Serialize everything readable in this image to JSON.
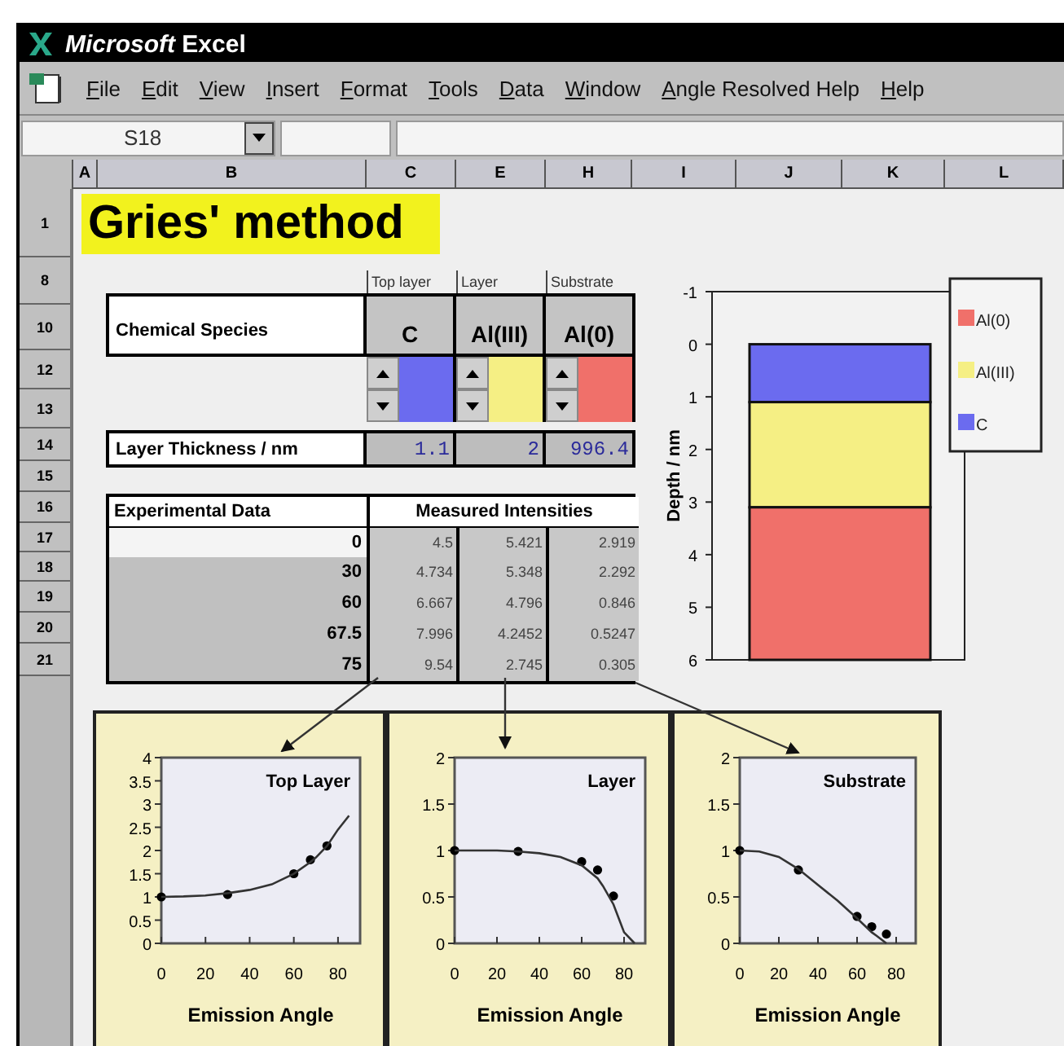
{
  "window": {
    "title": "**Microsoft** Excel"
  },
  "menu": [
    {
      "label": "File"
    },
    {
      "label": "Edit"
    },
    {
      "label": "View"
    },
    {
      "label": "Insert"
    },
    {
      "label": "Format"
    },
    {
      "label": "Tools"
    },
    {
      "label": "Data"
    },
    {
      "label": "Window"
    },
    {
      "label": "Angle Resolved Help"
    },
    {
      "label": "Help"
    }
  ],
  "name_box": {
    "value": "S18"
  },
  "column_headers": [
    "A",
    "B",
    "C",
    "E",
    "H",
    "I",
    "J",
    "K",
    "L"
  ],
  "row_headers": [
    "1",
    "8",
    "10",
    "12",
    "13",
    "14",
    "15",
    "16",
    "17",
    "18",
    "19",
    "20",
    "21"
  ],
  "title_cell": "Gries' method",
  "layer_table": {
    "species_label": "Chemical Species",
    "thickness_label": "Layer Thickness / nm",
    "layers": [
      {
        "caption": "Top layer",
        "species": "C",
        "color": "#6b6bef",
        "thickness": "1.1"
      },
      {
        "caption": "Layer",
        "species": "Al(III)",
        "color": "#f5ef84",
        "thickness": "2"
      },
      {
        "caption": "Substrate",
        "species": "Al(0)",
        "color": "#f0706a",
        "thickness": "996.4"
      }
    ]
  },
  "data_table": {
    "label": "Experimental Data",
    "header": "Measured Intensities",
    "rows": [
      {
        "angle": "0",
        "values": [
          "4.5",
          "5.421",
          "2.919"
        ]
      },
      {
        "angle": "30",
        "values": [
          "4.734",
          "5.348",
          "2.292"
        ]
      },
      {
        "angle": "60",
        "values": [
          "6.667",
          "4.796",
          "0.846"
        ]
      },
      {
        "angle": "67.5",
        "values": [
          "7.996",
          "4.2452",
          "0.5247"
        ]
      },
      {
        "angle": "75",
        "values": [
          "9.54",
          "2.745",
          "0.305"
        ]
      }
    ]
  },
  "depth_chart": {
    "chart_data": {
      "type": "bar",
      "stacked": true,
      "ylabel": "Depth / nm",
      "ylim": [
        6,
        -1
      ],
      "yticks": [
        -1,
        0,
        1,
        2,
        3,
        4,
        5,
        6
      ],
      "legend": "right",
      "series": [
        {
          "name": "Al(0)",
          "color": "#f0706a",
          "values": [
            2.9
          ]
        },
        {
          "name": "Al(III)",
          "color": "#f5ef84",
          "values": [
            2
          ]
        },
        {
          "name": "C",
          "color": "#6b6bef",
          "values": [
            1.1
          ]
        }
      ]
    }
  },
  "plots": [
    {
      "chart_data": {
        "type": "scatter",
        "title": "Top Layer",
        "xlabel": "Emission Angle",
        "x": [
          0,
          10,
          20,
          30,
          40,
          50,
          60,
          67.5,
          70,
          75,
          80,
          85
        ],
        "xlim": [
          0,
          90
        ],
        "ylim": [
          0,
          4
        ],
        "xticks": [
          0,
          20,
          40,
          60,
          80
        ],
        "yticks": [
          0,
          0.5,
          1,
          1.5,
          2,
          2.5,
          3,
          3.5,
          4
        ],
        "series": [
          {
            "type": "scatter",
            "color": "#000000",
            "values": [
              1,
              null,
              null,
              1.05,
              null,
              null,
              1.5,
              1.8,
              null,
              2.1,
              null,
              null
            ]
          },
          {
            "type": "line",
            "color": "#333333",
            "values": [
              1,
              1.01,
              1.03,
              1.08,
              1.15,
              1.27,
              1.5,
              1.75,
              1.85,
              2.1,
              2.45,
              2.75
            ]
          }
        ]
      }
    },
    {
      "chart_data": {
        "type": "scatter",
        "title": "Layer",
        "xlabel": "Emission Angle",
        "x": [
          0,
          10,
          20,
          30,
          40,
          50,
          60,
          67.5,
          70,
          75,
          80,
          85
        ],
        "xlim": [
          0,
          90
        ],
        "ylim": [
          0,
          2
        ],
        "xticks": [
          0,
          20,
          40,
          60,
          80
        ],
        "yticks": [
          0,
          0.5,
          1,
          1.5,
          2
        ],
        "series": [
          {
            "type": "scatter",
            "color": "#000000",
            "values": [
              1,
              null,
              null,
              0.99,
              null,
              null,
              0.88,
              0.79,
              null,
              0.51,
              null,
              null
            ]
          },
          {
            "type": "line",
            "color": "#333333",
            "values": [
              1,
              1,
              1,
              0.99,
              0.97,
              0.93,
              0.84,
              0.7,
              0.62,
              0.42,
              0.12,
              0
            ]
          }
        ]
      }
    },
    {
      "chart_data": {
        "type": "scatter",
        "title": "Substrate",
        "xlabel": "Emission Angle",
        "x": [
          0,
          10,
          20,
          30,
          40,
          50,
          60,
          67.5,
          70,
          75
        ],
        "xlim": [
          0,
          90
        ],
        "ylim": [
          0,
          2
        ],
        "xticks": [
          0,
          20,
          40,
          60,
          80
        ],
        "yticks": [
          0,
          0.5,
          1,
          1.5,
          2
        ],
        "series": [
          {
            "type": "scatter",
            "color": "#000000",
            "values": [
              1,
              null,
              null,
              0.79,
              null,
              null,
              0.29,
              0.18,
              null,
              0.1
            ]
          },
          {
            "type": "line",
            "color": "#333333",
            "values": [
              1,
              0.99,
              0.93,
              0.8,
              0.63,
              0.46,
              0.27,
              0.12,
              0.08,
              0
            ]
          }
        ]
      }
    }
  ]
}
